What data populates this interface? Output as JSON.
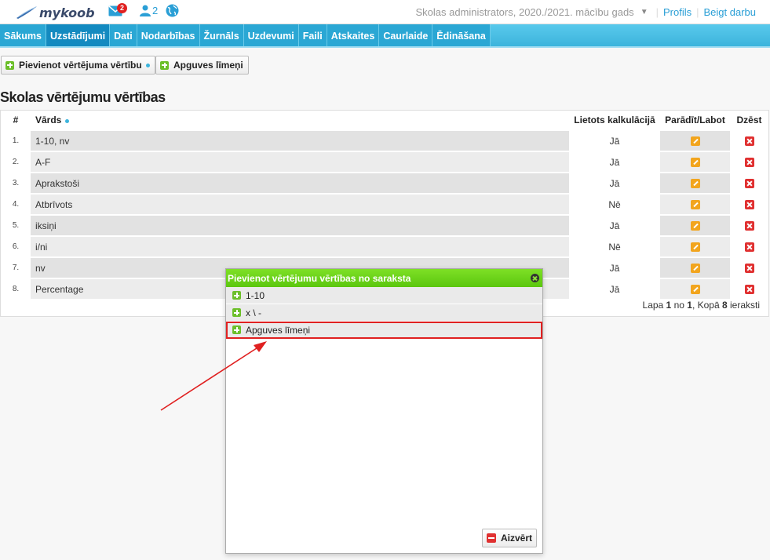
{
  "header": {
    "logo_text": "mykoob",
    "mail_badge": "2",
    "users_count": "2",
    "school_label": "Skolas administrators, 2020./2021. mācību gads",
    "profile_link": "Profils",
    "logout_link": "Beigt darbu"
  },
  "nav": {
    "items": [
      "Sākums",
      "Uzstādījumi",
      "Dati",
      "Nodarbības",
      "Žurnāls",
      "Uzdevumi",
      "Faili",
      "Atskaites",
      "Caurlaide",
      "Ēdināšana"
    ],
    "active": "Uzstādījumi"
  },
  "toolbar": {
    "add_value_label": "Pievienot vērtējuma vērtību",
    "levels_label": "Apguves līmeņi"
  },
  "page_title": "Skolas vērtējumu vērtības",
  "table": {
    "columns": {
      "num": "#",
      "name": "Vārds",
      "calc": "Lietots kalkulācijā",
      "edit": "Parādīt/Labot",
      "delete": "Dzēst"
    },
    "rows": [
      {
        "num": "1.",
        "name": "1-10, nv",
        "calc": "Jā"
      },
      {
        "num": "2.",
        "name": "A-F",
        "calc": "Jā"
      },
      {
        "num": "3.",
        "name": "Aprakstoši",
        "calc": "Jā"
      },
      {
        "num": "4.",
        "name": "Atbrīvots",
        "calc": "Nē"
      },
      {
        "num": "5.",
        "name": "iksiņi",
        "calc": "Jā"
      },
      {
        "num": "6.",
        "name": "i/ni",
        "calc": "Nē"
      },
      {
        "num": "7.",
        "name": "nv",
        "calc": "Jā"
      },
      {
        "num": "8.",
        "name": "Percentage",
        "calc": "Jā"
      }
    ],
    "pager": {
      "prefix": "Lapa ",
      "page": "1",
      "mid": " no ",
      "pages": "1",
      "mid2": ", Kopā ",
      "total": "8",
      "suffix": " ieraksti"
    }
  },
  "dialog": {
    "title": "Pievienot vērtējumu vērtības no saraksta",
    "items": [
      "1-10",
      "x \\ -",
      "Apguves līmeņi"
    ],
    "close_label": "Aizvērt"
  },
  "colors": {
    "nav": "#3cb4dc",
    "dialog_header": "#6ad41a",
    "highlight": "#e02020"
  }
}
